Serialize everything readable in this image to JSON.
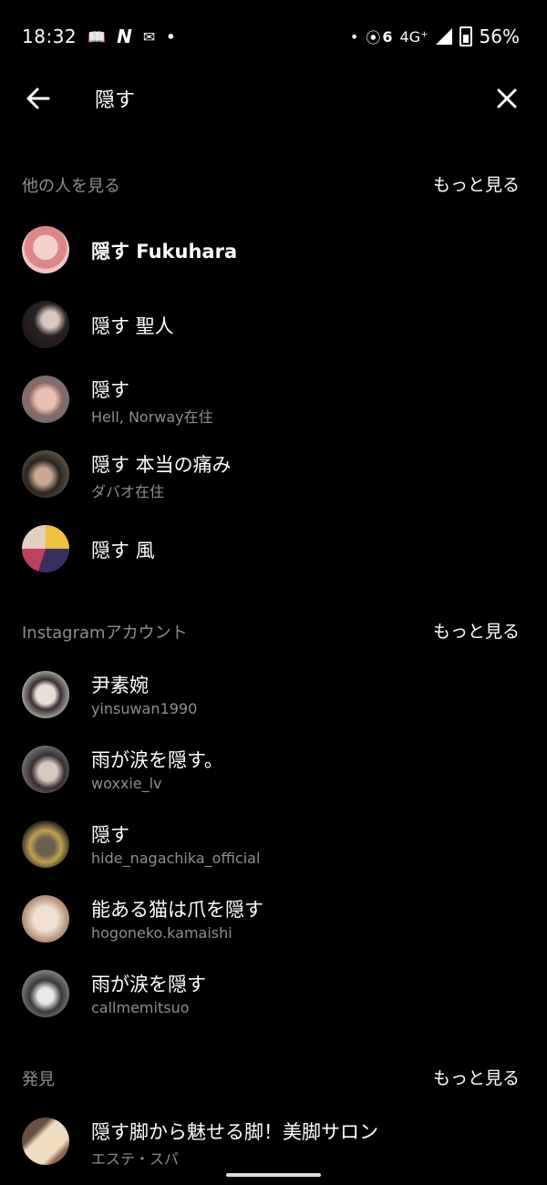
{
  "status_bar": {
    "time": "18:32",
    "left_icons": [
      "book-icon",
      "n-icon",
      "mail-icon",
      "dot-icon"
    ],
    "hotspot_count": "6",
    "network": "4G⁺",
    "battery": "56%"
  },
  "search": {
    "query": "隠す"
  },
  "sections": {
    "people": {
      "title": "他の人を見る",
      "see_more": "もっと見る",
      "items": [
        {
          "title": "隠す Fukuhara",
          "subtitle": "",
          "avatar_color": "#e8b8b8"
        },
        {
          "title": "隠す 聖人",
          "subtitle": "",
          "avatar_color": "#3a3030"
        },
        {
          "title": "隠す",
          "subtitle": "Hell, Norway在住",
          "avatar_color": "#a88a82"
        },
        {
          "title": "隠す 本当の痛み",
          "subtitle": "ダバオ在住",
          "avatar_color": "#4a4038"
        },
        {
          "title": "隠す 風",
          "subtitle": "",
          "avatar_color": "#6a4a70"
        }
      ]
    },
    "accounts": {
      "title": "Instagramアカウント",
      "see_more": "もっと見る",
      "items": [
        {
          "title": "尹素婉",
          "subtitle": "yinsuwan1990",
          "avatar_color": "#9a9a9a"
        },
        {
          "title": "雨が涙を隠す。",
          "subtitle": "woxxie_lv",
          "avatar_color": "#5a5050"
        },
        {
          "title": "隠す",
          "subtitle": "hide_nagachika_official",
          "avatar_color": "#2a2820"
        },
        {
          "title": "能ある猫は爪を隠す",
          "subtitle": "hogoneko.kamaishi",
          "avatar_color": "#c8a890"
        },
        {
          "title": "雨が涙を隠す",
          "subtitle": "callmemitsuo",
          "avatar_color": "#707070"
        }
      ]
    },
    "discover": {
      "title": "発見",
      "see_more": "もっと見る",
      "items": [
        {
          "title": "隠す脚から魅せる脚！美脚サロン",
          "subtitle": "エステ・スパ",
          "avatar_color": "#d8c0a0"
        }
      ]
    }
  }
}
